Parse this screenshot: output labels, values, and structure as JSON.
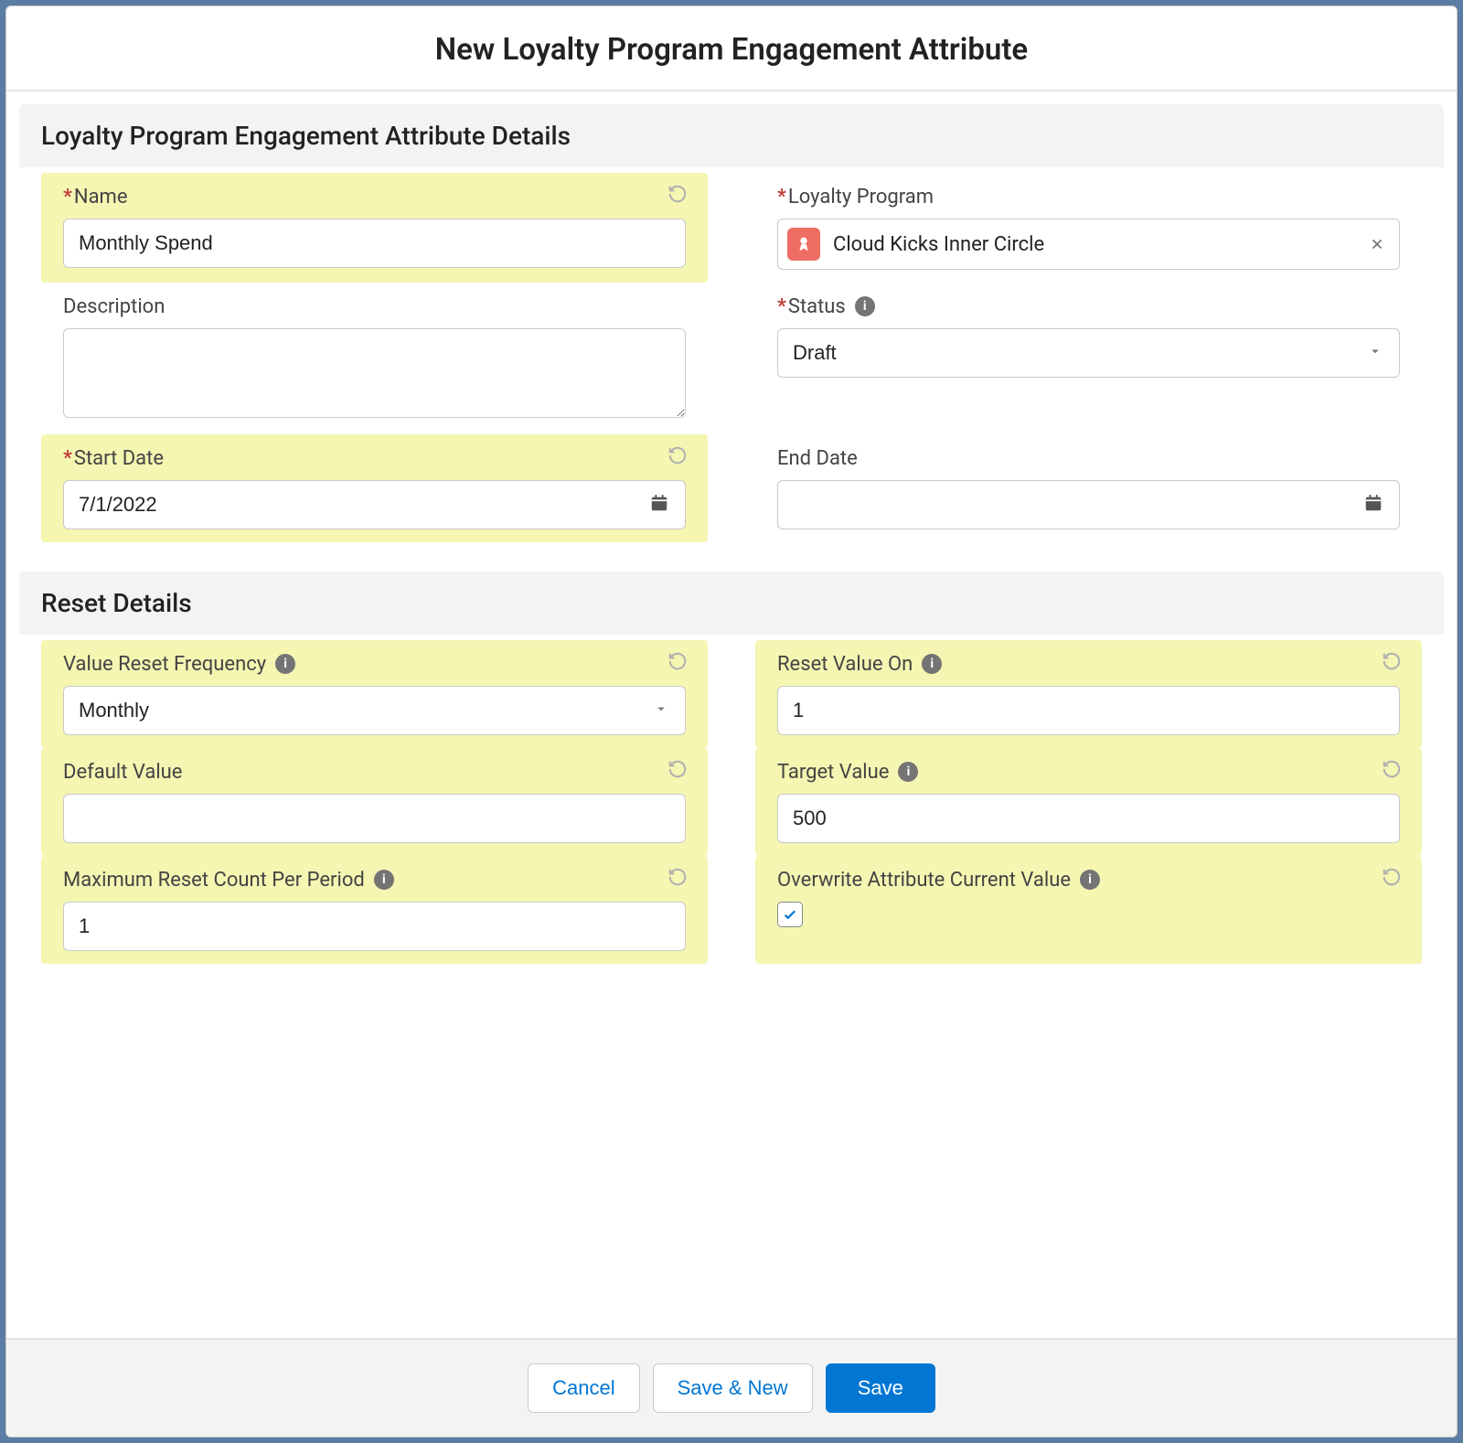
{
  "modal": {
    "title": "New Loyalty Program Engagement Attribute"
  },
  "sections": {
    "details": {
      "header": "Loyalty Program Engagement Attribute Details",
      "name": {
        "label": "Name",
        "value": "Monthly Spend"
      },
      "loyalty_program": {
        "label": "Loyalty Program",
        "value": "Cloud Kicks Inner Circle"
      },
      "description": {
        "label": "Description",
        "value": ""
      },
      "status": {
        "label": "Status",
        "value": "Draft"
      },
      "start_date": {
        "label": "Start Date",
        "value": "7/1/2022"
      },
      "end_date": {
        "label": "End Date",
        "value": ""
      }
    },
    "reset": {
      "header": "Reset Details",
      "value_reset_frequency": {
        "label": "Value Reset Frequency",
        "value": "Monthly"
      },
      "reset_value_on": {
        "label": "Reset Value On",
        "value": "1"
      },
      "default_value": {
        "label": "Default Value",
        "value": ""
      },
      "target_value": {
        "label": "Target Value",
        "value": "500"
      },
      "max_reset_count": {
        "label": "Maximum Reset Count Per Period",
        "value": "1"
      },
      "overwrite_current": {
        "label": "Overwrite Attribute Current Value",
        "checked": true
      }
    }
  },
  "footer": {
    "cancel": "Cancel",
    "save_new": "Save & New",
    "save": "Save"
  }
}
